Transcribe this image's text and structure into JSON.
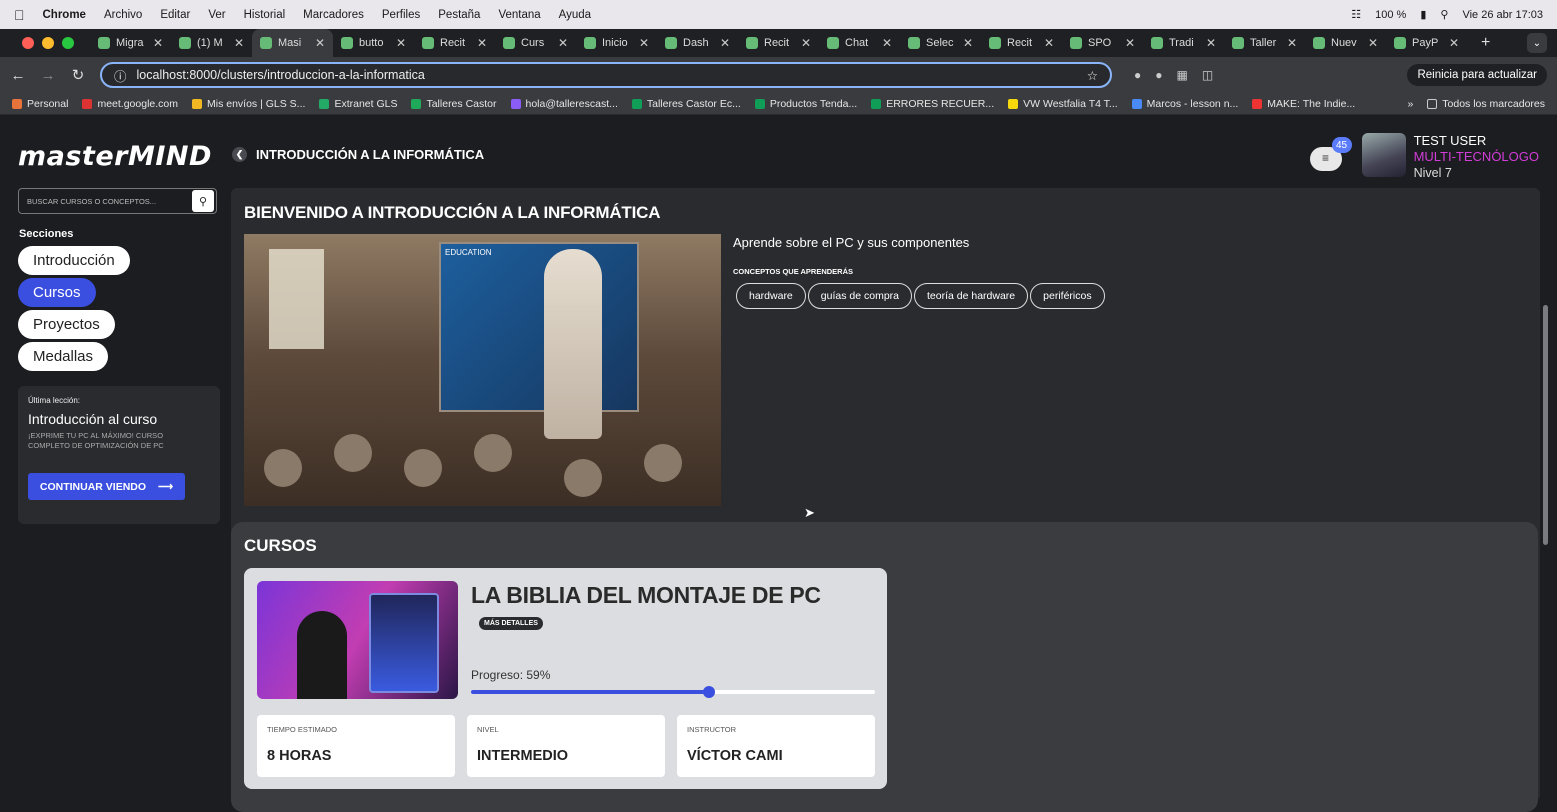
{
  "mac_menu": {
    "app": "Chrome",
    "items": [
      "Archivo",
      "Editar",
      "Ver",
      "Historial",
      "Marcadores",
      "Perfiles",
      "Pestaña",
      "Ventana",
      "Ayuda"
    ],
    "battery": "100 %",
    "datetime": "Vie 26 abr 17:03"
  },
  "tabs": [
    {
      "label": "Migra"
    },
    {
      "label": "(1) M"
    },
    {
      "label": "Masi",
      "active": true
    },
    {
      "label": "butto"
    },
    {
      "label": "Recit"
    },
    {
      "label": "Curs"
    },
    {
      "label": "Inicio"
    },
    {
      "label": "Dash"
    },
    {
      "label": "Recit"
    },
    {
      "label": "Chat"
    },
    {
      "label": "Selec"
    },
    {
      "label": "Recit"
    },
    {
      "label": "SPO"
    },
    {
      "label": "Tradi"
    },
    {
      "label": "Taller"
    },
    {
      "label": "Nuev"
    },
    {
      "label": "PayP"
    }
  ],
  "address": {
    "url": "localhost:8000/clusters/introduccion-a-la-informatica",
    "restart": "Reinicia para actualizar"
  },
  "bookmarks": [
    "Personal",
    "meet.google.com",
    "Mis envíos | GLS S...",
    "Extranet GLS",
    "Talleres Castor",
    "hola@tallerescast...",
    "Talleres Castor Ec...",
    "Productos Tenda...",
    "ERRORES RECUER...",
    "VW Westfalia T4 T...",
    "Marcos - lesson n...",
    "MAKE: The Indie...",
    "Todos los marcadores"
  ],
  "site": {
    "logo": "masterMIND",
    "breadcrumb": "INTRODUCCIÓN A LA INFORMÁTICA",
    "notifications": "45",
    "user": {
      "name": "TEST USER",
      "role": "MULTI-TECNÓLOGO",
      "level": "Nivel 7"
    }
  },
  "sidebar": {
    "search_placeholder": "BUSCAR CURSOS O CONCEPTOS...",
    "sections_title": "Secciones",
    "sections": [
      "Introducción",
      "Cursos",
      "Proyectos",
      "Medallas"
    ],
    "last_lesson": {
      "label": "Última lección:",
      "title": "Introducción al curso",
      "course": "¡EXPRIME TU PC AL MÁXIMO! CURSO COMPLETO DE OPTIMIZACIÓN DE PC",
      "button": "CONTINUAR VIENDO"
    }
  },
  "main": {
    "welcome": "BIENVENIDO A INTRODUCCIÓN A LA INFORMÁTICA",
    "board_text": "EDUCATION",
    "description": "Aprende sobre el PC y sus componentes",
    "concepts_label": "CONCEPTOS QUE APRENDERÁS",
    "tags": [
      "hardware",
      "guías de compra",
      "teoría de hardware",
      "periféricos"
    ]
  },
  "courses": {
    "title": "CURSOS",
    "card": {
      "title": "LA BIBLIA DEL MONTAJE DE PC",
      "more": "MÁS DETALLES",
      "progress_label": "Progreso: 59%",
      "progress": 0.59,
      "stats": [
        {
          "k": "TIEMPO ESTIMADO",
          "v": "8 HORAS"
        },
        {
          "k": "NIVEL",
          "v": "INTERMEDIO"
        },
        {
          "k": "INSTRUCTOR",
          "v": "VÍCTOR CAMI"
        }
      ]
    }
  },
  "colors": {
    "accent": "#3a4fe0",
    "role": "#d23cd8"
  }
}
